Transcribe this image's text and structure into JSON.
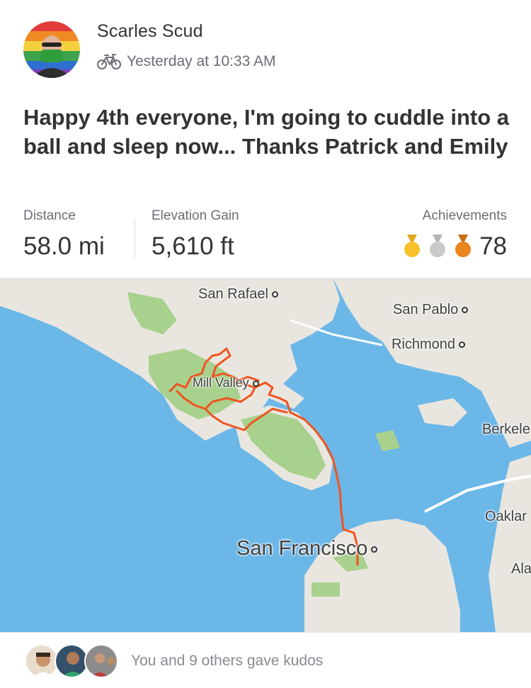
{
  "activity": {
    "athlete_name": "Scarles Scud",
    "timestamp": "Yesterday at 10:33 AM",
    "activity_type_icon": "bike-icon",
    "title": "Happy 4th everyone, I'm going to cuddle into a ball and sleep now... Thanks Patrick and Emily"
  },
  "stats": {
    "distance_label": "Distance",
    "distance_value": "58.0 mi",
    "elevation_label": "Elevation Gain",
    "elevation_value": "5,610 ft",
    "achievements_label": "Achievements",
    "achievements_value": "78",
    "medals": [
      "gold-medal-icon",
      "silver-medal-icon",
      "bronze-medal-icon"
    ]
  },
  "map": {
    "labels": {
      "san_rafael": "San Rafael",
      "san_pablo": "San Pablo",
      "richmond": "Richmond",
      "mill_valley": "Mill Valley",
      "berkeley": "Berkele",
      "oakland": "Oaklar",
      "alameda": "Ala",
      "san_francisco": "San Francisco"
    },
    "colors": {
      "water": "#6bb7e8",
      "land": "#e9e6df",
      "park": "#a9d18e",
      "route": "#f0541e"
    }
  },
  "kudos": {
    "text": "You and 9 others gave kudos"
  },
  "colors": {
    "gold": "#f7c12b",
    "silver": "#c9c9c9",
    "bronze": "#e8851c"
  }
}
